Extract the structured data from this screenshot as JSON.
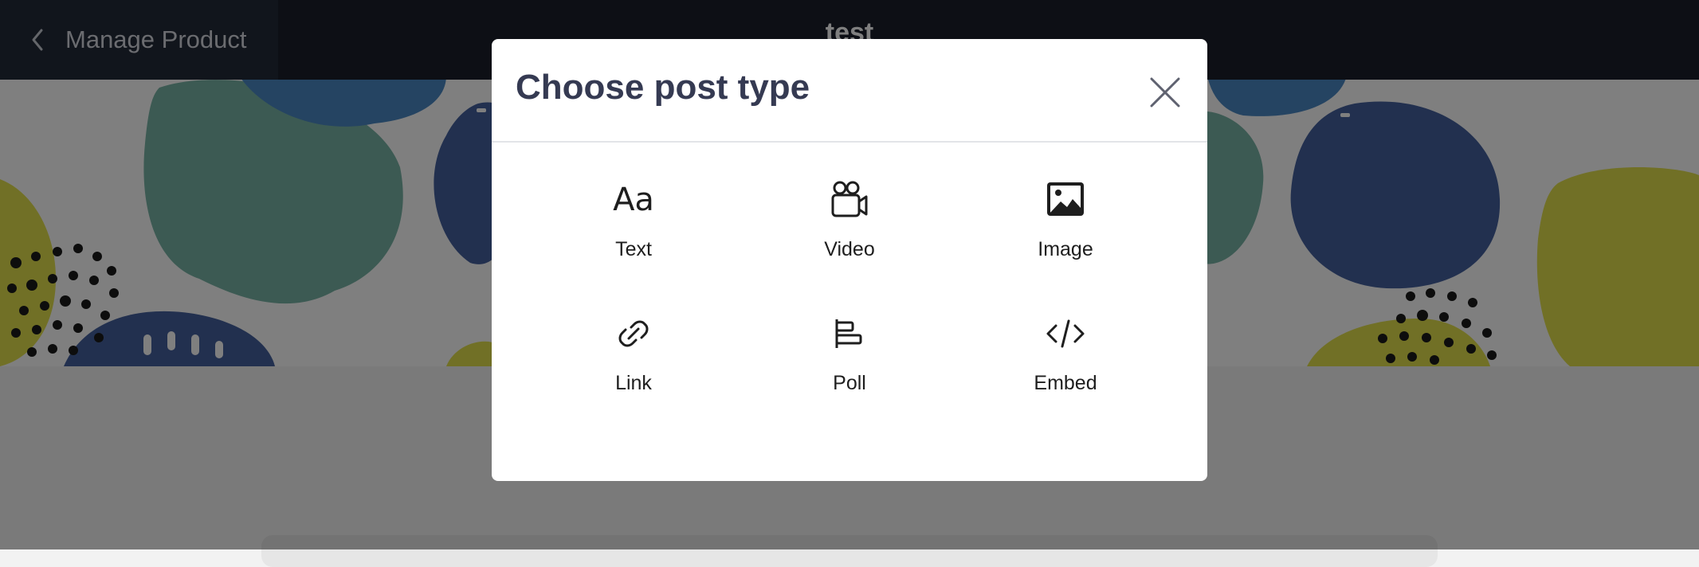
{
  "header": {
    "back_label": "Manage Product",
    "title": "test"
  },
  "modal": {
    "title": "Choose post type",
    "options": [
      {
        "label": "Text",
        "icon": "text-icon",
        "glyph": "Aa"
      },
      {
        "label": "Video",
        "icon": "video-camera-icon"
      },
      {
        "label": "Image",
        "icon": "image-icon"
      },
      {
        "label": "Link",
        "icon": "link-icon"
      },
      {
        "label": "Poll",
        "icon": "poll-icon"
      },
      {
        "label": "Embed",
        "icon": "code-icon"
      }
    ]
  },
  "colors": {
    "topbar": "#1a1f2b",
    "modal_title": "#353a52",
    "banner_teal": "#78b4a6",
    "banner_navy": "#44609e",
    "banner_blue": "#4a88c4",
    "banner_olive": "#e2e04c"
  }
}
